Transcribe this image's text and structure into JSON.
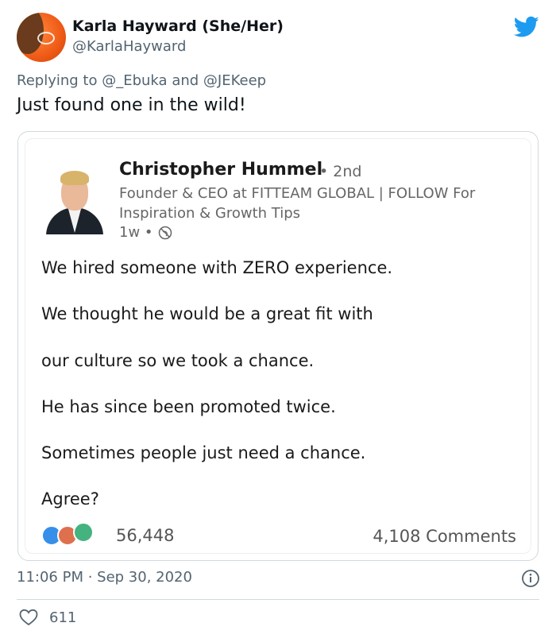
{
  "tweet": {
    "author_name": "Karla Hayward (She/Her)",
    "author_handle": "@KarlaHayward",
    "replying_prefix": "Replying to",
    "replying_mention_1": "@_Ebuka",
    "replying_and": "and",
    "replying_mention_2": "@JEKeep",
    "text": "Just found one in the wild!",
    "timestamp": "11:06 PM · Sep 30, 2020",
    "like_count": "611",
    "brand_color": "#1d9bf0"
  },
  "embed": {
    "author_name": "Christopher Hummel",
    "degree": "• 2nd",
    "headline": "Founder & CEO at FITTEAM GLOBAL | FOLLOW For Inspiration & Growth Tips",
    "posted_ago": "1w •",
    "post_lines": [
      "We hired someone with ZERO experience.",
      "We thought he would be a great fit with",
      "our culture so we took a chance.",
      "He has since been promoted twice.",
      "Sometimes people just need a chance.",
      "Agree?"
    ],
    "reaction_count": "56,448",
    "comments_label": "4,108 Comments"
  }
}
